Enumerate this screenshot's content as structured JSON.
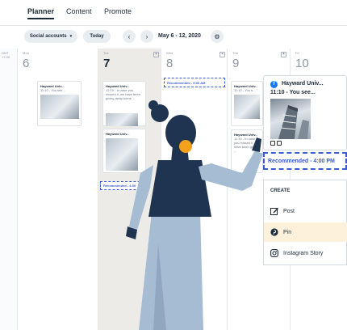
{
  "nav": {
    "tabs": [
      {
        "label": "Planner",
        "active": true
      },
      {
        "label": "Content",
        "active": false
      },
      {
        "label": "Promote",
        "active": false
      }
    ]
  },
  "toolbar": {
    "social_accounts_label": "Social accounts",
    "today_label": "Today",
    "date_range": "May 6 - 12, 2020"
  },
  "calendar": {
    "timezone": "GMT\n+7:00",
    "days": [
      {
        "name": "Mon",
        "number": "6"
      },
      {
        "name": "Tue",
        "number": "7"
      },
      {
        "name": "Wed",
        "number": "8"
      },
      {
        "name": "Thu",
        "number": "9"
      },
      {
        "name": "Fri",
        "number": "10"
      }
    ],
    "cards": {
      "mon": {
        "title": "Hayward Univ...",
        "snippet": "11:10 - You see..."
      },
      "tue1": {
        "title": "Hayward Univ...",
        "snippet": "12:10 - In case you missed it, we have been giving away some ..."
      },
      "tue2": {
        "title": "Hayward Univ...",
        "snippet": ""
      },
      "thu1": {
        "title": "Hayward Univ...",
        "snippet": "11:10 - You s..."
      },
      "thu2": {
        "title": "Hayward Univ...",
        "snippet": "11:30 - In case you missed it, we have been giving ..."
      }
    },
    "recommended": {
      "wed": "Recommended - 9:00 AM",
      "tue": "Recommended - 4:00"
    }
  },
  "popover": {
    "title": "Hayward Univ...",
    "time_snippet": "11:10 - You see...",
    "recommended": "Recommended - 4:00 PM"
  },
  "create_menu": {
    "header": "CREATE",
    "items": [
      {
        "label": "Post",
        "icon": "edit-icon",
        "selected": false
      },
      {
        "label": "Pin",
        "icon": "pinterest-icon",
        "selected": true
      },
      {
        "label": "Instagram Story",
        "icon": "instagram-icon",
        "selected": false
      }
    ]
  },
  "colors": {
    "accent": "#3b5bd1",
    "highlight": "#fdf1dc",
    "today_column": "#ecebe7",
    "facebook": "#1877f2"
  }
}
